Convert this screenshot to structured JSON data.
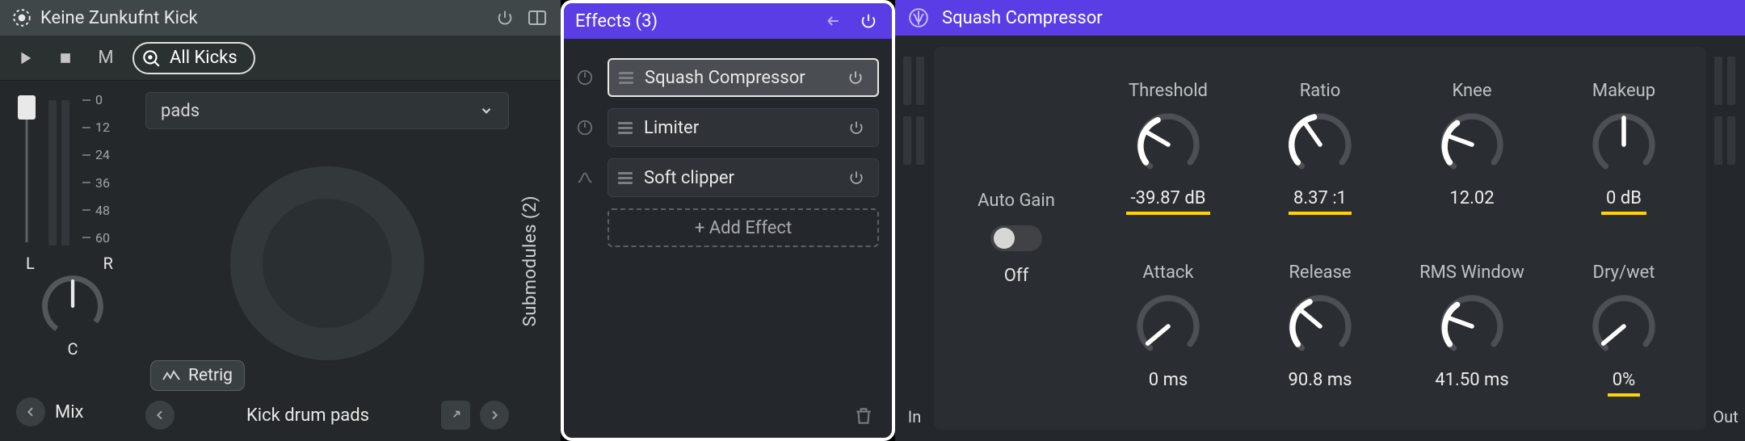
{
  "module": {
    "title": "Keine Zunkufnt Kick",
    "kicks_label": "All Kicks",
    "m_button": "M",
    "fader": {
      "ticks": [
        "0",
        "12",
        "24",
        "36",
        "48",
        "60"
      ]
    },
    "pan": {
      "L": "L",
      "R": "R",
      "C": "C"
    },
    "mix_label": "Mix",
    "pads_select": "pads",
    "retrig": "Retrig",
    "pads_title": "Kick drum pads",
    "submodules": "Submodules (2)"
  },
  "effects": {
    "title": "Effects (3)",
    "items": [
      {
        "name": "Squash Compressor",
        "selected": true,
        "icon": "compressor-icon"
      },
      {
        "name": "Limiter",
        "selected": false,
        "icon": "compressor-icon"
      },
      {
        "name": "Soft clipper",
        "selected": false,
        "icon": "clipper-icon"
      }
    ],
    "add": "+ Add Effect"
  },
  "detail": {
    "title": "Squash Compressor",
    "in_label": "In",
    "out_label": "Out",
    "autogain": {
      "label": "Auto Gain",
      "state": "Off"
    },
    "knobs": {
      "threshold": {
        "label": "Threshold",
        "value": "-39.87 dB",
        "mod": true,
        "angle": -60
      },
      "ratio": {
        "label": "Ratio",
        "value": "8.37 :1",
        "mod": true,
        "angle": -35
      },
      "knee": {
        "label": "Knee",
        "value": "12.02",
        "mod": false,
        "angle": -70
      },
      "makeup": {
        "label": "Makeup",
        "value": "0 dB",
        "mod": true,
        "angle": 0
      },
      "attack": {
        "label": "Attack",
        "value": "0 ms",
        "mod": false,
        "angle": -130
      },
      "release": {
        "label": "Release",
        "value": "90.8 ms",
        "mod": false,
        "angle": -50
      },
      "rms": {
        "label": "RMS Window",
        "value": "41.50 ms",
        "mod": false,
        "angle": -70
      },
      "drywet": {
        "label": "Dry/wet",
        "value": "0%",
        "mod": true,
        "angle": -130
      }
    }
  }
}
